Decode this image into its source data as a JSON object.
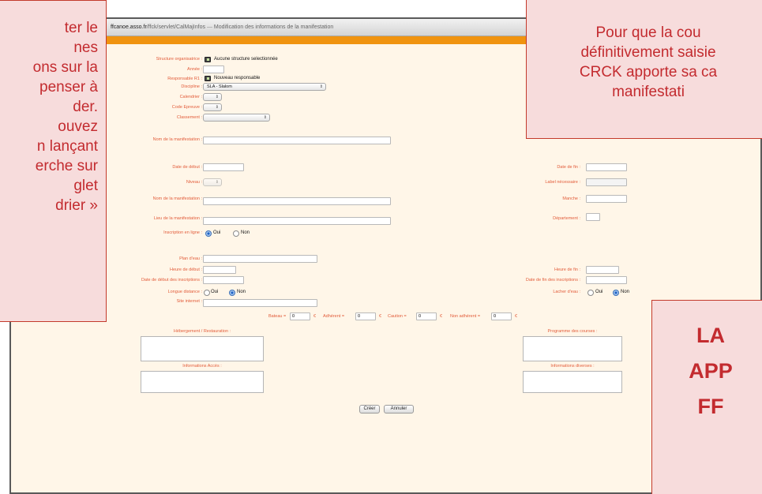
{
  "browser": {
    "url_host": "ffcanoe.asso.fr",
    "url_path": "/ffck/servlet/CalMajInfos",
    "separator": "—",
    "page_title": "Modification des informations de la manifestation"
  },
  "form": {
    "structure_label": "Structure organisatrice :",
    "structure_value": "Aucune structure selectionnée",
    "annee_label": "Année :",
    "responsable_label": "Responsable R1 :",
    "responsable_value": "Nouveau responsable",
    "discipline_label": "Discipline :",
    "discipline_value": "SLA - Slalom",
    "calendrier_label": "Calendrier :",
    "code_epreuve_label": "Code Epreuve :",
    "classement_label": "Classement :",
    "nom_label": "Nom de la manifestation :",
    "date_debut_label": "Date de début :",
    "date_fin_label": "Date de fin :",
    "niveau_label": "Niveau :",
    "label_necessaire_label": "Label nécessaire :",
    "nom_label_2": "Nom de la manifestation :",
    "manche_label": "Manche :",
    "lieu_label": "Lieu de la manifestation :",
    "departement_label": "Département :",
    "inscription_label": "Inscription en ligne :",
    "oui": "Oui",
    "non": "Non",
    "plan_eau_label": "Plan d'eau :",
    "heure_debut_label": "Heure de début :",
    "heure_fin_label": "Heure de fin :",
    "date_debut_inscr_label": "Date de début des inscriptions :",
    "date_fin_inscr_label": "Date de fin des inscriptions :",
    "longue_distance_label": "Longue distance :",
    "lacher_eau_label": "Lacher d'eau :",
    "site_internet_label": "Site internet :",
    "bateau_label": "Bateau =",
    "bateau_value": "0",
    "adherent_label": "Adhérent =",
    "adherent_value": "0",
    "caution_label": "Caution =",
    "caution_value": "0",
    "non_adherent_label": "Non adhérent =",
    "non_adherent_value": "0",
    "currency": "€",
    "hebergement_label": "Hébergement / Restauration :",
    "programme_label": "Programme des courses :",
    "info_acces_label": "Informations Accès :",
    "info_diverses_label": "Informations diverses :",
    "creer_button": "Créer",
    "annuler_button": "Annuler"
  },
  "callouts": {
    "left_lines": [
      "ter le",
      "nes",
      "ons sur la",
      "penser à",
      "der.",
      "ouvez",
      "n lançant",
      "erche sur",
      "glet",
      "drier »"
    ],
    "right_lines": [
      "Pour que la cou",
      "définitivement saisie",
      "CRCK apporte sa ca",
      "manifestati"
    ],
    "bottom_lines": [
      "LA",
      "APP",
      "FF"
    ]
  },
  "colors": {
    "page_bg": "#fff6e8",
    "label": "#e25c3a",
    "accent_bar": "#f0930f",
    "callout_bg": "#f7dcdc",
    "callout_text": "#c32b2f"
  }
}
